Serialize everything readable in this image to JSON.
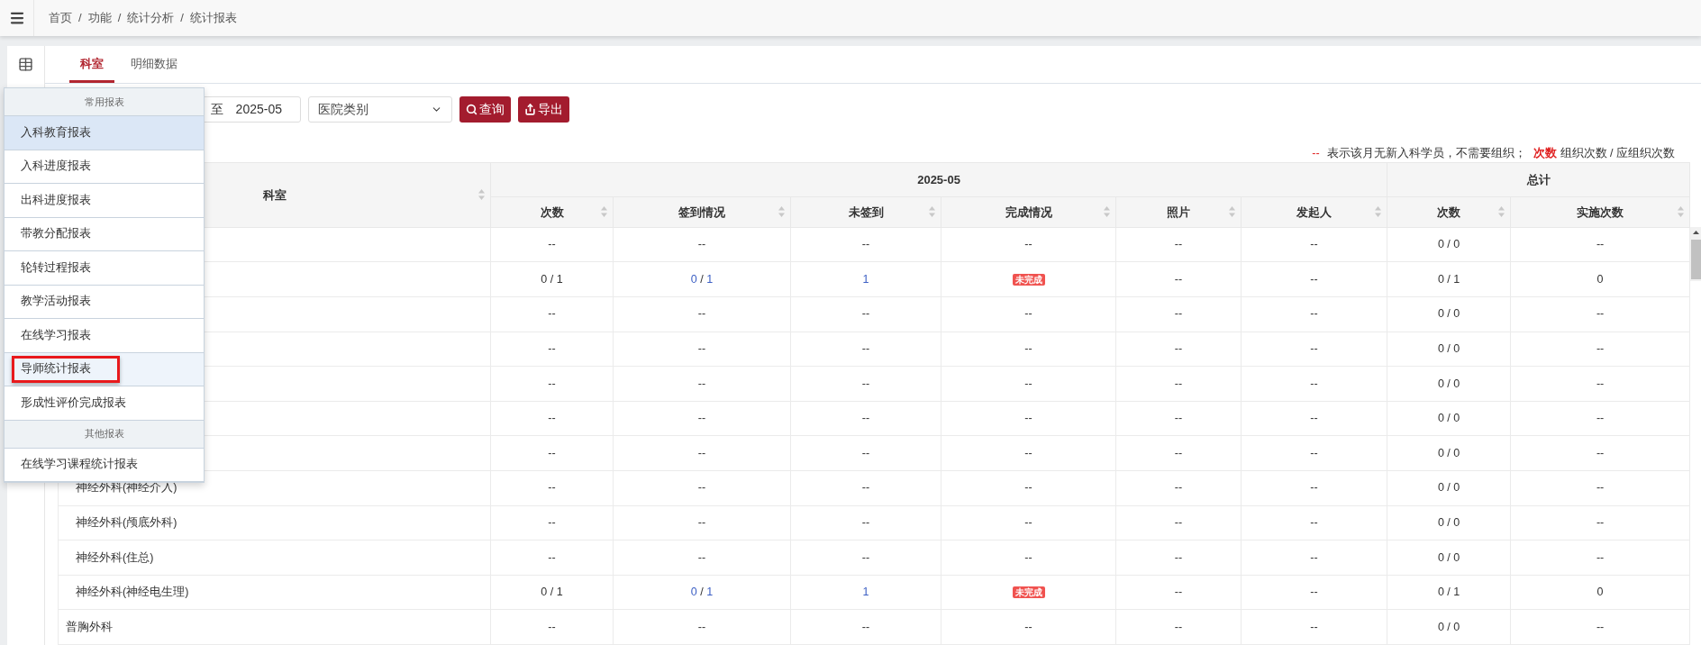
{
  "breadcrumb": [
    "首页",
    "功能",
    "统计分析",
    "统计报表"
  ],
  "breadcrumb_separator": "/",
  "tabs": [
    {
      "label": "科室",
      "selected": true
    },
    {
      "label": "明细数据",
      "selected": false
    }
  ],
  "filters": {
    "range_separator": "至",
    "end_month": "2025-05",
    "hospital_type": "医院类别"
  },
  "buttons": [
    {
      "label": "查询",
      "kind": "search"
    },
    {
      "label": "导出",
      "kind": "export"
    }
  ],
  "legend": {
    "dash": "--",
    "dash_meaning": "表示该月无新入科学员，不需要组织；",
    "count_term": "次数",
    "count_meaning": "组织次数 / 应组织次数"
  },
  "table": {
    "dept_header": "科室",
    "groups": [
      {
        "label": "2025-05",
        "columns": [
          "次数",
          "签到情况",
          "未签到",
          "完成情况",
          "照片",
          "发起人"
        ]
      },
      {
        "label": "总计",
        "columns": [
          "次数",
          "实施次数"
        ]
      }
    ],
    "rows": [
      {
        "cells": [
          "--",
          "--",
          "--",
          "--",
          "--",
          "--",
          "0 / 0",
          "--"
        ]
      },
      {
        "cells": [
          "0 / 1",
          {
            "kind": "ratio",
            "parts": [
              "0",
              "/",
              "1"
            ]
          },
          {
            "kind": "link",
            "text": "1"
          },
          {
            "kind": "badge",
            "text": "未完成"
          },
          "--",
          "--",
          "0 / 1",
          "0"
        ]
      },
      {
        "cells": [
          "--",
          "--",
          "--",
          "--",
          "--",
          "--",
          "0 / 0",
          "--"
        ]
      },
      {
        "cells": [
          "--",
          "--",
          "--",
          "--",
          "--",
          "--",
          "0 / 0",
          "--"
        ]
      },
      {
        "cells": [
          "--",
          "--",
          "--",
          "--",
          "--",
          "--",
          "0 / 0",
          "--"
        ]
      },
      {
        "cells": [
          "--",
          "--",
          "--",
          "--",
          "--",
          "--",
          "0 / 0",
          "--"
        ]
      },
      {
        "cells": [
          "--",
          "--",
          "--",
          "--",
          "--",
          "--",
          "0 / 0",
          "--"
        ]
      },
      {
        "kind": "sub",
        "dept": "神经外科(神经介入)",
        "cells": [
          "--",
          "--",
          "--",
          "--",
          "--",
          "--",
          "0 / 0",
          "--"
        ]
      },
      {
        "kind": "sub",
        "dept": "神经外科(颅底外科)",
        "cells": [
          "--",
          "--",
          "--",
          "--",
          "--",
          "--",
          "0 / 0",
          "--"
        ]
      },
      {
        "kind": "sub",
        "dept": "神经外科(住总)",
        "cells": [
          "--",
          "--",
          "--",
          "--",
          "--",
          "--",
          "0 / 0",
          "--"
        ]
      },
      {
        "kind": "sub",
        "dept": "神经外科(神经电生理)",
        "cells": [
          "0 / 1",
          {
            "kind": "ratio",
            "parts": [
              "0",
              "/",
              "1"
            ]
          },
          {
            "kind": "link",
            "text": "1"
          },
          {
            "kind": "badge",
            "text": "未完成"
          },
          "--",
          "--",
          "0 / 1",
          "0"
        ]
      },
      {
        "kind": "top",
        "dept": "普胸外科",
        "cells": [
          "--",
          "--",
          "--",
          "--",
          "--",
          "--",
          "0 / 0",
          "--"
        ]
      }
    ]
  },
  "report_menu": {
    "sections": [
      {
        "title": "常用报表",
        "items": [
          {
            "label": "入科教育报表",
            "selected": true,
            "hovered": false,
            "annotated": false
          },
          {
            "label": "入科进度报表",
            "selected": false,
            "hovered": false,
            "annotated": false
          },
          {
            "label": "出科进度报表",
            "selected": false,
            "hovered": false,
            "annotated": false
          },
          {
            "label": "带教分配报表",
            "selected": false,
            "hovered": false,
            "annotated": false
          },
          {
            "label": "轮转过程报表",
            "selected": false,
            "hovered": false,
            "annotated": false
          },
          {
            "label": "教学活动报表",
            "selected": false,
            "hovered": false,
            "annotated": false
          },
          {
            "label": "在线学习报表",
            "selected": false,
            "hovered": false,
            "annotated": false
          },
          {
            "label": "导师统计报表",
            "selected": false,
            "hovered": true,
            "annotated": true
          },
          {
            "label": "形成性评价完成报表",
            "selected": false,
            "hovered": false,
            "annotated": false
          }
        ]
      },
      {
        "title": "其他报表",
        "items": [
          {
            "label": "在线学习课程统计报表",
            "selected": false,
            "hovered": false,
            "annotated": false
          }
        ]
      }
    ]
  }
}
